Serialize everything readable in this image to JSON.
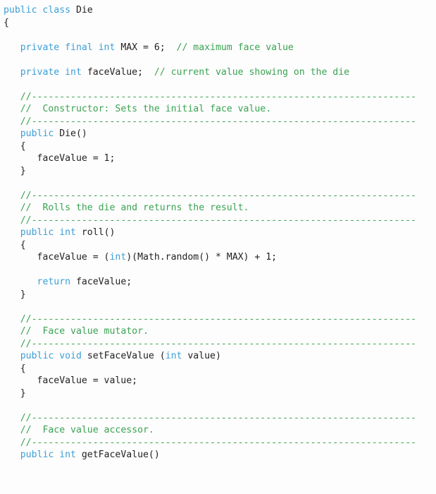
{
  "document": {
    "type": "java-source-listing",
    "class_name": "Die",
    "language": "Java",
    "colors": {
      "background": "#fdfdfd",
      "plain_text": "#231f20",
      "keyword": "#3d9fd6",
      "comment": "#3aa352"
    },
    "separator_comment": "//---------------------------------------------------------------------"
  },
  "lines": [
    {
      "id": "line-1",
      "text": "public class Die",
      "tokens": [
        {
          "t": "public class ",
          "c": "kw"
        },
        {
          "t": "Die",
          "c": "pl"
        }
      ]
    },
    {
      "id": "line-2",
      "text": "{",
      "tokens": [
        {
          "t": "{",
          "c": "pl"
        }
      ]
    },
    {
      "id": "line-3",
      "text": "",
      "tokens": []
    },
    {
      "id": "line-4",
      "text": "   private final int MAX = 6;  // maximum face value",
      "tokens": [
        {
          "t": "   ",
          "c": "pl"
        },
        {
          "t": "private final int ",
          "c": "kw"
        },
        {
          "t": "MAX = 6;  ",
          "c": "pl"
        },
        {
          "t": "// maximum face value",
          "c": "cm"
        }
      ]
    },
    {
      "id": "line-5",
      "text": "",
      "tokens": []
    },
    {
      "id": "line-6",
      "text": "   private int faceValue;  // current value showing on the die",
      "tokens": [
        {
          "t": "   ",
          "c": "pl"
        },
        {
          "t": "private int ",
          "c": "kw"
        },
        {
          "t": "faceValue;  ",
          "c": "pl"
        },
        {
          "t": "// current value showing on the die",
          "c": "cm"
        }
      ]
    },
    {
      "id": "line-7",
      "text": "",
      "tokens": []
    },
    {
      "id": "line-8",
      "text": "   //---------------------------------------------------------------------",
      "tokens": [
        {
          "t": "   ",
          "c": "pl"
        },
        {
          "t": "//---------------------------------------------------------------------",
          "c": "cm"
        }
      ]
    },
    {
      "id": "line-9",
      "text": "   //  Constructor: Sets the initial face value.",
      "tokens": [
        {
          "t": "   ",
          "c": "pl"
        },
        {
          "t": "//  Constructor: Sets the initial face value.",
          "c": "cm"
        }
      ]
    },
    {
      "id": "line-10",
      "text": "   //---------------------------------------------------------------------",
      "tokens": [
        {
          "t": "   ",
          "c": "pl"
        },
        {
          "t": "//---------------------------------------------------------------------",
          "c": "cm"
        }
      ]
    },
    {
      "id": "line-11",
      "text": "   public Die()",
      "tokens": [
        {
          "t": "   ",
          "c": "pl"
        },
        {
          "t": "public ",
          "c": "kw"
        },
        {
          "t": "Die()",
          "c": "pl"
        }
      ]
    },
    {
      "id": "line-12",
      "text": "   {",
      "tokens": [
        {
          "t": "   {",
          "c": "pl"
        }
      ]
    },
    {
      "id": "line-13",
      "text": "      faceValue = 1;",
      "tokens": [
        {
          "t": "      faceValue = 1;",
          "c": "pl"
        }
      ]
    },
    {
      "id": "line-14",
      "text": "   }",
      "tokens": [
        {
          "t": "   }",
          "c": "pl"
        }
      ]
    },
    {
      "id": "line-15",
      "text": "",
      "tokens": []
    },
    {
      "id": "line-16",
      "text": "   //---------------------------------------------------------------------",
      "tokens": [
        {
          "t": "   ",
          "c": "pl"
        },
        {
          "t": "//---------------------------------------------------------------------",
          "c": "cm"
        }
      ]
    },
    {
      "id": "line-17",
      "text": "   //  Rolls the die and returns the result.",
      "tokens": [
        {
          "t": "   ",
          "c": "pl"
        },
        {
          "t": "//  Rolls the die and returns the result.",
          "c": "cm"
        }
      ]
    },
    {
      "id": "line-18",
      "text": "   //---------------------------------------------------------------------",
      "tokens": [
        {
          "t": "   ",
          "c": "pl"
        },
        {
          "t": "//---------------------------------------------------------------------",
          "c": "cm"
        }
      ]
    },
    {
      "id": "line-19",
      "text": "   public int roll()",
      "tokens": [
        {
          "t": "   ",
          "c": "pl"
        },
        {
          "t": "public int ",
          "c": "kw"
        },
        {
          "t": "roll()",
          "c": "pl"
        }
      ]
    },
    {
      "id": "line-20",
      "text": "   {",
      "tokens": [
        {
          "t": "   {",
          "c": "pl"
        }
      ]
    },
    {
      "id": "line-21",
      "text": "      faceValue = (int)(Math.random() * MAX) + 1;",
      "tokens": [
        {
          "t": "      faceValue = (",
          "c": "pl"
        },
        {
          "t": "int",
          "c": "kw"
        },
        {
          "t": ")(Math.random() * MAX) + 1;",
          "c": "pl"
        }
      ]
    },
    {
      "id": "line-22",
      "text": "",
      "tokens": []
    },
    {
      "id": "line-23",
      "text": "      return faceValue;",
      "tokens": [
        {
          "t": "      ",
          "c": "pl"
        },
        {
          "t": "return",
          "c": "kw"
        },
        {
          "t": " faceValue;",
          "c": "pl"
        }
      ]
    },
    {
      "id": "line-24",
      "text": "   }",
      "tokens": [
        {
          "t": "   }",
          "c": "pl"
        }
      ]
    },
    {
      "id": "line-25",
      "text": "",
      "tokens": []
    },
    {
      "id": "line-26",
      "text": "   //---------------------------------------------------------------------",
      "tokens": [
        {
          "t": "   ",
          "c": "pl"
        },
        {
          "t": "//---------------------------------------------------------------------",
          "c": "cm"
        }
      ]
    },
    {
      "id": "line-27",
      "text": "   //  Face value mutator.",
      "tokens": [
        {
          "t": "   ",
          "c": "pl"
        },
        {
          "t": "//  Face value mutator.",
          "c": "cm"
        }
      ]
    },
    {
      "id": "line-28",
      "text": "   //---------------------------------------------------------------------",
      "tokens": [
        {
          "t": "   ",
          "c": "pl"
        },
        {
          "t": "//---------------------------------------------------------------------",
          "c": "cm"
        }
      ]
    },
    {
      "id": "line-29",
      "text": "   public void setFaceValue (int value)",
      "tokens": [
        {
          "t": "   ",
          "c": "pl"
        },
        {
          "t": "public void ",
          "c": "kw"
        },
        {
          "t": "setFaceValue (",
          "c": "pl"
        },
        {
          "t": "int",
          "c": "kw"
        },
        {
          "t": " value)",
          "c": "pl"
        }
      ]
    },
    {
      "id": "line-30",
      "text": "   {",
      "tokens": [
        {
          "t": "   {",
          "c": "pl"
        }
      ]
    },
    {
      "id": "line-31",
      "text": "      faceValue = value;",
      "tokens": [
        {
          "t": "      faceValue = value;",
          "c": "pl"
        }
      ]
    },
    {
      "id": "line-32",
      "text": "   }",
      "tokens": [
        {
          "t": "   }",
          "c": "pl"
        }
      ]
    },
    {
      "id": "line-33",
      "text": "",
      "tokens": []
    },
    {
      "id": "line-34",
      "text": "   //---------------------------------------------------------------------",
      "tokens": [
        {
          "t": "   ",
          "c": "pl"
        },
        {
          "t": "//---------------------------------------------------------------------",
          "c": "cm"
        }
      ]
    },
    {
      "id": "line-35",
      "text": "   //  Face value accessor.",
      "tokens": [
        {
          "t": "   ",
          "c": "pl"
        },
        {
          "t": "//  Face value accessor.",
          "c": "cm"
        }
      ]
    },
    {
      "id": "line-36",
      "text": "   //---------------------------------------------------------------------",
      "tokens": [
        {
          "t": "   ",
          "c": "pl"
        },
        {
          "t": "//---------------------------------------------------------------------",
          "c": "cm"
        }
      ]
    },
    {
      "id": "line-37",
      "text": "   public int getFaceValue()",
      "tokens": [
        {
          "t": "   ",
          "c": "pl"
        },
        {
          "t": "public int ",
          "c": "kw"
        },
        {
          "t": "getFaceValue()",
          "c": "pl"
        }
      ]
    }
  ]
}
